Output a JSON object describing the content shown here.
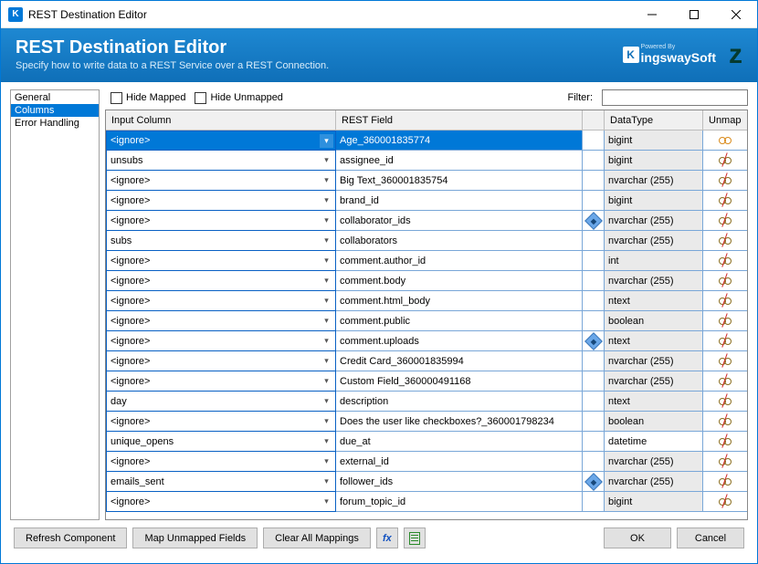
{
  "window": {
    "title": "REST Destination Editor"
  },
  "banner": {
    "title": "REST Destination Editor",
    "subtitle": "Specify how to write data to a REST Service over a REST Connection.",
    "logo_powered": "Powered By",
    "logo_brand": "ingswaySoft"
  },
  "sidebar": {
    "items": [
      {
        "label": "General",
        "selected": false
      },
      {
        "label": "Columns",
        "selected": true
      },
      {
        "label": "Error Handling",
        "selected": false
      }
    ]
  },
  "toolbar": {
    "hide_mapped_label": "Hide Mapped",
    "hide_unmapped_label": "Hide Unmapped",
    "filter_label": "Filter:",
    "filter_value": ""
  },
  "grid": {
    "headers": {
      "input": "Input Column",
      "rest": "REST Field",
      "type": "DataType",
      "unmap": "Unmap"
    },
    "rows": [
      {
        "input": "<ignore>",
        "rest": "Age_360001835774",
        "flag": false,
        "type": "bigint",
        "type_editable": false,
        "selected": true
      },
      {
        "input": "unsubs",
        "rest": "assignee_id",
        "flag": false,
        "type": "bigint",
        "type_editable": false,
        "selected": false
      },
      {
        "input": "<ignore>",
        "rest": "Big Text_360001835754",
        "flag": false,
        "type": "nvarchar (255)",
        "type_editable": false,
        "selected": false
      },
      {
        "input": "<ignore>",
        "rest": "brand_id",
        "flag": false,
        "type": "bigint",
        "type_editable": false,
        "selected": false
      },
      {
        "input": "<ignore>",
        "rest": "collaborator_ids",
        "flag": true,
        "type": "nvarchar (255)",
        "type_editable": false,
        "selected": false
      },
      {
        "input": "subs",
        "rest": "collaborators",
        "flag": false,
        "type": "nvarchar (255)",
        "type_editable": false,
        "selected": false
      },
      {
        "input": "<ignore>",
        "rest": "comment.author_id",
        "flag": false,
        "type": "int",
        "type_editable": false,
        "selected": false
      },
      {
        "input": "<ignore>",
        "rest": "comment.body",
        "flag": false,
        "type": "nvarchar (255)",
        "type_editable": false,
        "selected": false
      },
      {
        "input": "<ignore>",
        "rest": "comment.html_body",
        "flag": false,
        "type": "ntext",
        "type_editable": false,
        "selected": false
      },
      {
        "input": "<ignore>",
        "rest": "comment.public",
        "flag": false,
        "type": "boolean",
        "type_editable": false,
        "selected": false
      },
      {
        "input": "<ignore>",
        "rest": "comment.uploads",
        "flag": true,
        "type": "ntext",
        "type_editable": false,
        "selected": false
      },
      {
        "input": "<ignore>",
        "rest": "Credit Card_360001835994",
        "flag": false,
        "type": "nvarchar (255)",
        "type_editable": false,
        "selected": false
      },
      {
        "input": "<ignore>",
        "rest": "Custom Field_360000491168",
        "flag": false,
        "type": "nvarchar (255)",
        "type_editable": false,
        "selected": false
      },
      {
        "input": "day",
        "rest": "description",
        "flag": false,
        "type": "ntext",
        "type_editable": false,
        "selected": false
      },
      {
        "input": "<ignore>",
        "rest": "Does the user like checkboxes?_360001798234",
        "flag": false,
        "type": "boolean",
        "type_editable": false,
        "selected": false
      },
      {
        "input": "unique_opens",
        "rest": "due_at",
        "flag": false,
        "type": "datetime",
        "type_editable": true,
        "selected": false
      },
      {
        "input": "<ignore>",
        "rest": "external_id",
        "flag": false,
        "type": "nvarchar (255)",
        "type_editable": false,
        "selected": false
      },
      {
        "input": "emails_sent",
        "rest": "follower_ids",
        "flag": true,
        "type": "nvarchar (255)",
        "type_editable": false,
        "selected": false
      },
      {
        "input": "<ignore>",
        "rest": "forum_topic_id",
        "flag": false,
        "type": "bigint",
        "type_editable": false,
        "selected": false
      }
    ]
  },
  "buttons": {
    "refresh": "Refresh Component",
    "map_unmapped": "Map Unmapped Fields",
    "clear_all": "Clear All Mappings",
    "ok": "OK",
    "cancel": "Cancel"
  }
}
